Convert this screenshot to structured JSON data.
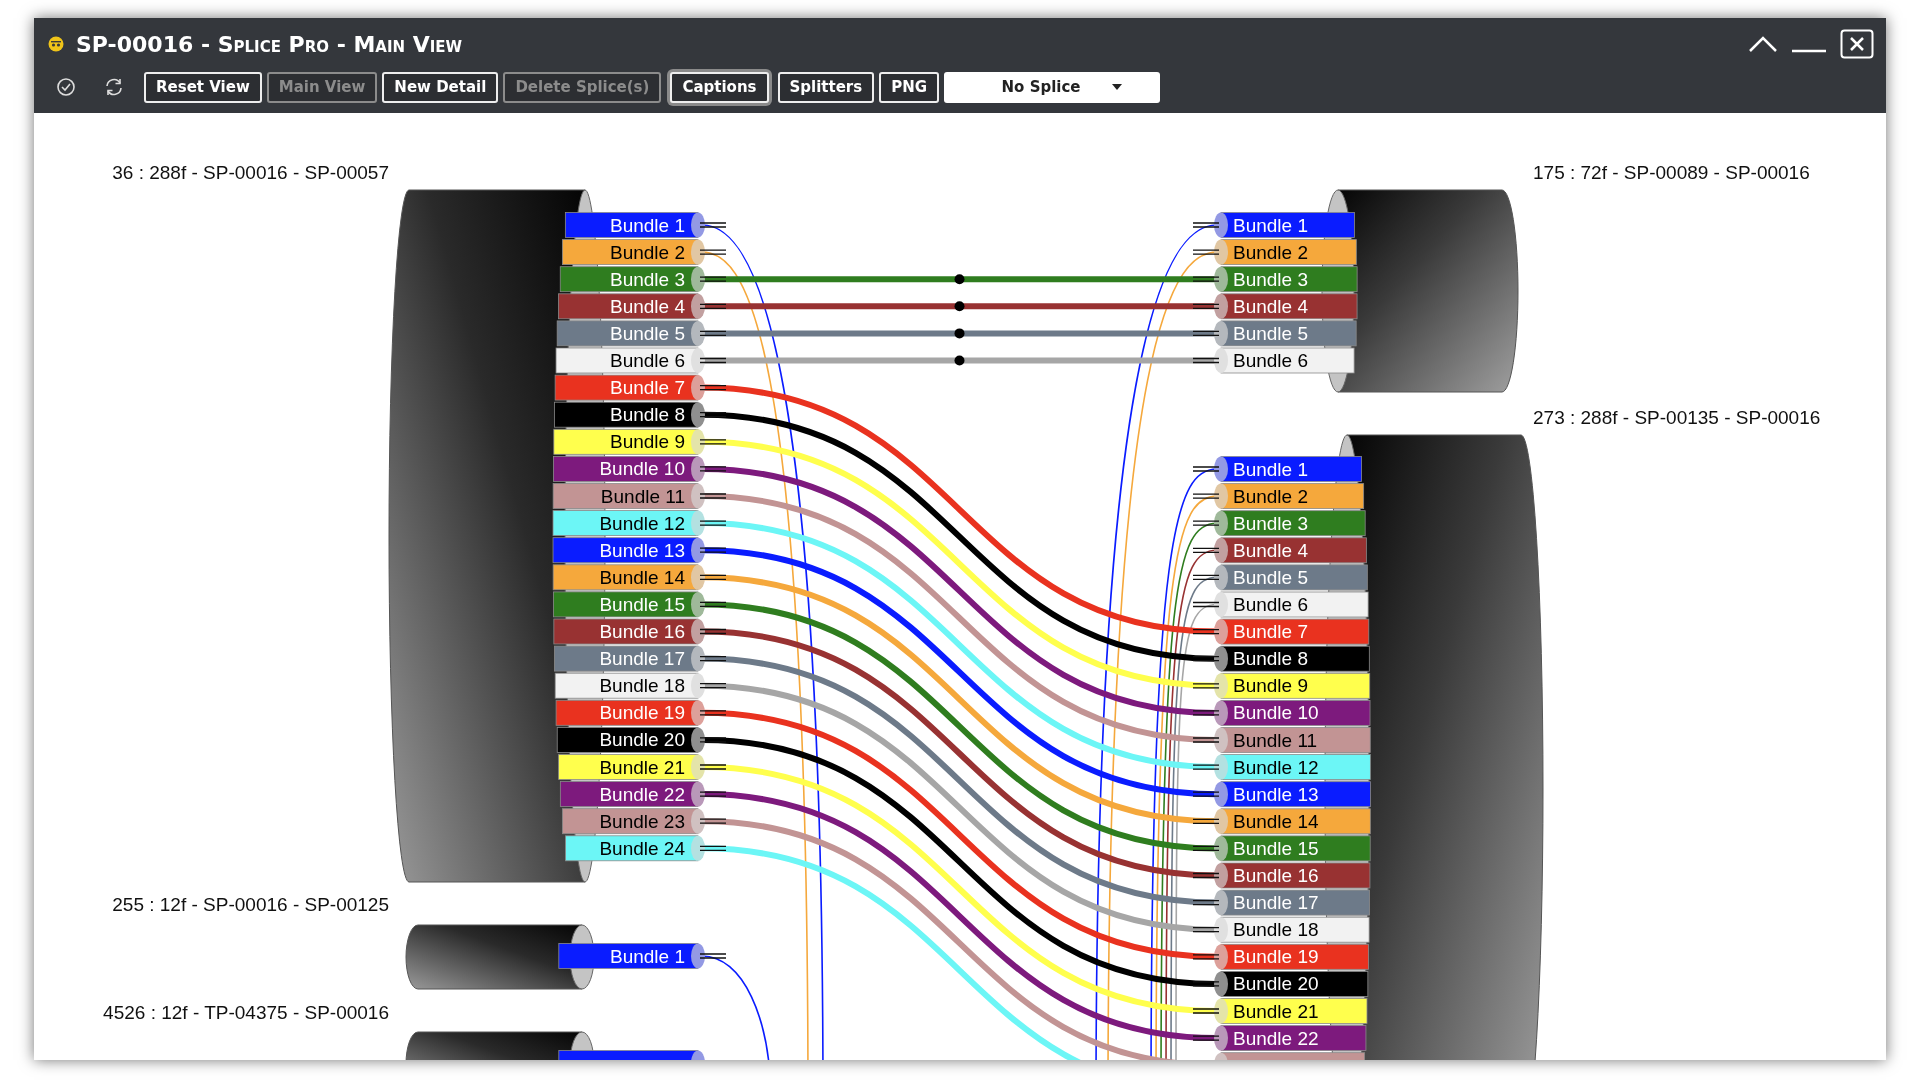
{
  "window": {
    "title": "SP-00016 - Splice Pro - Main View"
  },
  "toolbar": {
    "buttons": [
      {
        "label": "Reset View",
        "disabled": false,
        "selected": false
      },
      {
        "label": "Main View",
        "disabled": true,
        "selected": false
      },
      {
        "label": "New Detail",
        "disabled": false,
        "selected": false
      },
      {
        "label": "Delete Splice(s)",
        "disabled": true,
        "selected": false
      },
      {
        "label": "Captions",
        "disabled": false,
        "selected": true
      },
      {
        "label": "Splitters",
        "disabled": false,
        "selected": false
      },
      {
        "label": "PNG",
        "disabled": false,
        "selected": false
      }
    ],
    "dropdown": {
      "value": "No Splice"
    }
  },
  "cables": [
    {
      "label": "36 : 288f - SP-00016 - SP-00057",
      "kind": "left",
      "bundles": [
        {
          "label": "Bundle 1",
          "color": "#0a1cff",
          "kind": "open"
        },
        {
          "label": "Bundle 2",
          "color": "#f5a83c",
          "kind": "open"
        },
        {
          "label": "Bundle 3",
          "color": "#2f7d1f",
          "kind": "marked"
        },
        {
          "label": "Bundle 4",
          "color": "#983232",
          "kind": "marked"
        },
        {
          "label": "Bundle 5",
          "color": "#6d7a89",
          "kind": "marked"
        },
        {
          "label": "Bundle 6",
          "color": "#f2f2f2",
          "kind": "marked"
        },
        {
          "label": "Bundle 7",
          "color": "#e9321f",
          "kind": "plain"
        },
        {
          "label": "Bundle 8",
          "color": "#000000",
          "kind": "plain"
        },
        {
          "label": "Bundle 9",
          "color": "#ffff4d",
          "kind": "plain"
        },
        {
          "label": "Bundle 10",
          "color": "#7d1a7d",
          "kind": "plain"
        },
        {
          "label": "Bundle 11",
          "color": "#c29494",
          "kind": "plain"
        },
        {
          "label": "Bundle 12",
          "color": "#6cf6f6",
          "kind": "plain"
        },
        {
          "label": "Bundle 13",
          "color": "#0a1cff",
          "kind": "plain"
        },
        {
          "label": "Bundle 14",
          "color": "#f5a83c",
          "kind": "plain"
        },
        {
          "label": "Bundle 15",
          "color": "#2f7d1f",
          "kind": "plain"
        },
        {
          "label": "Bundle 16",
          "color": "#983232",
          "kind": "plain"
        },
        {
          "label": "Bundle 17",
          "color": "#6d7a89",
          "kind": "plain"
        },
        {
          "label": "Bundle 18",
          "color": "#f2f2f2",
          "kind": "plain"
        },
        {
          "label": "Bundle 19",
          "color": "#e9321f",
          "kind": "plain"
        },
        {
          "label": "Bundle 20",
          "color": "#000000",
          "kind": "plain"
        },
        {
          "label": "Bundle 21",
          "color": "#ffff4d",
          "kind": "plain"
        },
        {
          "label": "Bundle 22",
          "color": "#7d1a7d",
          "kind": "plain"
        },
        {
          "label": "Bundle 23",
          "color": "#c29494",
          "kind": "plain"
        },
        {
          "label": "Bundle 24",
          "color": "#6cf6f6",
          "kind": "plain"
        }
      ]
    },
    {
      "label": "175 : 72f - SP-00089 - SP-00016",
      "kind": "right",
      "bundles": [
        {
          "label": "Bundle 1",
          "color": "#0a1cff",
          "kind": "open"
        },
        {
          "label": "Bundle 2",
          "color": "#f5a83c",
          "kind": "open"
        },
        {
          "label": "Bundle 3",
          "color": "#2f7d1f",
          "kind": "marked"
        },
        {
          "label": "Bundle 4",
          "color": "#983232",
          "kind": "marked"
        },
        {
          "label": "Bundle 5",
          "color": "#6d7a89",
          "kind": "marked"
        },
        {
          "label": "Bundle 6",
          "color": "#f2f2f2",
          "kind": "marked"
        }
      ]
    },
    {
      "label": "273 : 288f - SP-00135 - SP-00016",
      "kind": "right",
      "bundles": [
        {
          "label": "Bundle 1",
          "color": "#0a1cff",
          "kind": "open"
        },
        {
          "label": "Bundle 2",
          "color": "#f5a83c",
          "kind": "open"
        },
        {
          "label": "Bundle 3",
          "color": "#2f7d1f",
          "kind": "open"
        },
        {
          "label": "Bundle 4",
          "color": "#983232",
          "kind": "open"
        },
        {
          "label": "Bundle 5",
          "color": "#6d7a89",
          "kind": "open"
        },
        {
          "label": "Bundle 6",
          "color": "#f2f2f2",
          "kind": "open"
        },
        {
          "label": "Bundle 7",
          "color": "#e9321f",
          "kind": "plain"
        },
        {
          "label": "Bundle 8",
          "color": "#000000",
          "kind": "plain"
        },
        {
          "label": "Bundle 9",
          "color": "#ffff4d",
          "kind": "plain"
        },
        {
          "label": "Bundle 10",
          "color": "#7d1a7d",
          "kind": "plain"
        },
        {
          "label": "Bundle 11",
          "color": "#c29494",
          "kind": "plain"
        },
        {
          "label": "Bundle 12",
          "color": "#6cf6f6",
          "kind": "plain"
        },
        {
          "label": "Bundle 13",
          "color": "#0a1cff",
          "kind": "plain"
        },
        {
          "label": "Bundle 14",
          "color": "#f5a83c",
          "kind": "plain"
        },
        {
          "label": "Bundle 15",
          "color": "#2f7d1f",
          "kind": "plain"
        },
        {
          "label": "Bundle 16",
          "color": "#983232",
          "kind": "plain"
        },
        {
          "label": "Bundle 17",
          "color": "#6d7a89",
          "kind": "plain"
        },
        {
          "label": "Bundle 18",
          "color": "#f2f2f2",
          "kind": "plain"
        },
        {
          "label": "Bundle 19",
          "color": "#e9321f",
          "kind": "plain"
        },
        {
          "label": "Bundle 20",
          "color": "#000000",
          "kind": "plain"
        },
        {
          "label": "Bundle 21",
          "color": "#ffff4d",
          "kind": "plain"
        },
        {
          "label": "Bundle 22",
          "color": "#7d1a7d",
          "kind": "plain"
        },
        {
          "color": "#c29494",
          "kind": "plain"
        }
      ]
    },
    {
      "label": "255 : 12f - SP-00016 - SP-00125",
      "kind": "left",
      "bundles": [
        {
          "label": "Bundle 1",
          "color": "#0a1cff",
          "kind": "open"
        }
      ]
    },
    {
      "label": "4526 : 12f - TP-04375 - SP-00016",
      "kind": "left",
      "bundles": [
        {
          "color": "#0a1cff",
          "kind": "open"
        }
      ]
    }
  ]
}
